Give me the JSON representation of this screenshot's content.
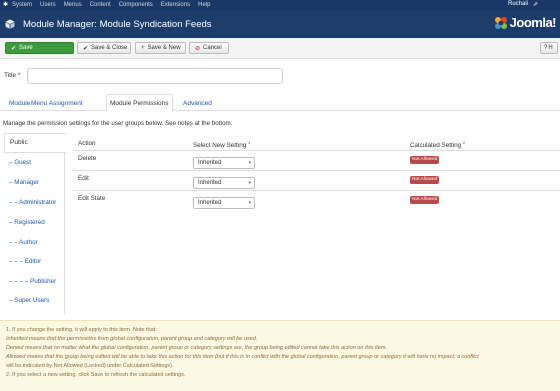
{
  "menubar": {
    "items": [
      "System",
      "Users",
      "Menus",
      "Content",
      "Components",
      "Extensions",
      "Help"
    ],
    "user": "Ruchali",
    "ext_icon": "external-link-icon"
  },
  "header": {
    "title": "Module Manager: Module Syndication Feeds",
    "logo_text": "Joomla!",
    "icon": "cube-icon"
  },
  "toolbar": {
    "save": "Save",
    "save_close": "Save & Close",
    "save_new": "Save & New",
    "cancel": "Cancel",
    "help": "H"
  },
  "form": {
    "title_label": "Title *",
    "title_value": ""
  },
  "tabs": [
    "Module",
    "Menu Assignment",
    "Module Permissions",
    "Advanced"
  ],
  "active_tab": "Module Permissions",
  "intro": "Manage the permission settings for the user groups below. See notes at the bottom.",
  "groups": {
    "public": "Public",
    "items": [
      "– Guest",
      "– Manager",
      "– – Administrator",
      "– Registered",
      "– – Author",
      "– – – Editor",
      "– – – – Publisher",
      "– Super Users"
    ]
  },
  "table": {
    "headers": {
      "action": "Action",
      "new_setting": "Select New Setting",
      "new_setting_sup": "1",
      "calculated": "Calculated Setting",
      "calculated_sup": "2"
    },
    "rows": [
      {
        "action": "Delete",
        "setting": "Inherited",
        "calculated": "Not Allowed"
      },
      {
        "action": "Edit",
        "setting": "Inherited",
        "calculated": "Not Allowed"
      },
      {
        "action": "Edit State",
        "setting": "Inherited",
        "calculated": "Not Allowed"
      }
    ]
  },
  "notes": [
    "1. If you change the setting, it will apply to this item. Note that:",
    "Inherited means that the permissions from global configuration, parent group and category will be used.",
    "Denied means that no matter what the global configuration, parent group or category settings are, the group being edited cannot take this action on this item.",
    "Allowed means that the group being edited will be able to take this action for this item (but if this is in conflict with the global configuration, parent group or category it will have no impact; a conflict",
    "will be indicated by Not Allowed (Locked) under Calculated Settings).",
    "2. If you select a new setting, click Save to refresh the calculated settings."
  ],
  "colors": {
    "header_bg": "#1c3d6c",
    "save_green": "#3d9a3d",
    "link_blue": "#1b57b1",
    "badge_red": "#b94a48",
    "notes_bg": "#fcf8e3"
  }
}
